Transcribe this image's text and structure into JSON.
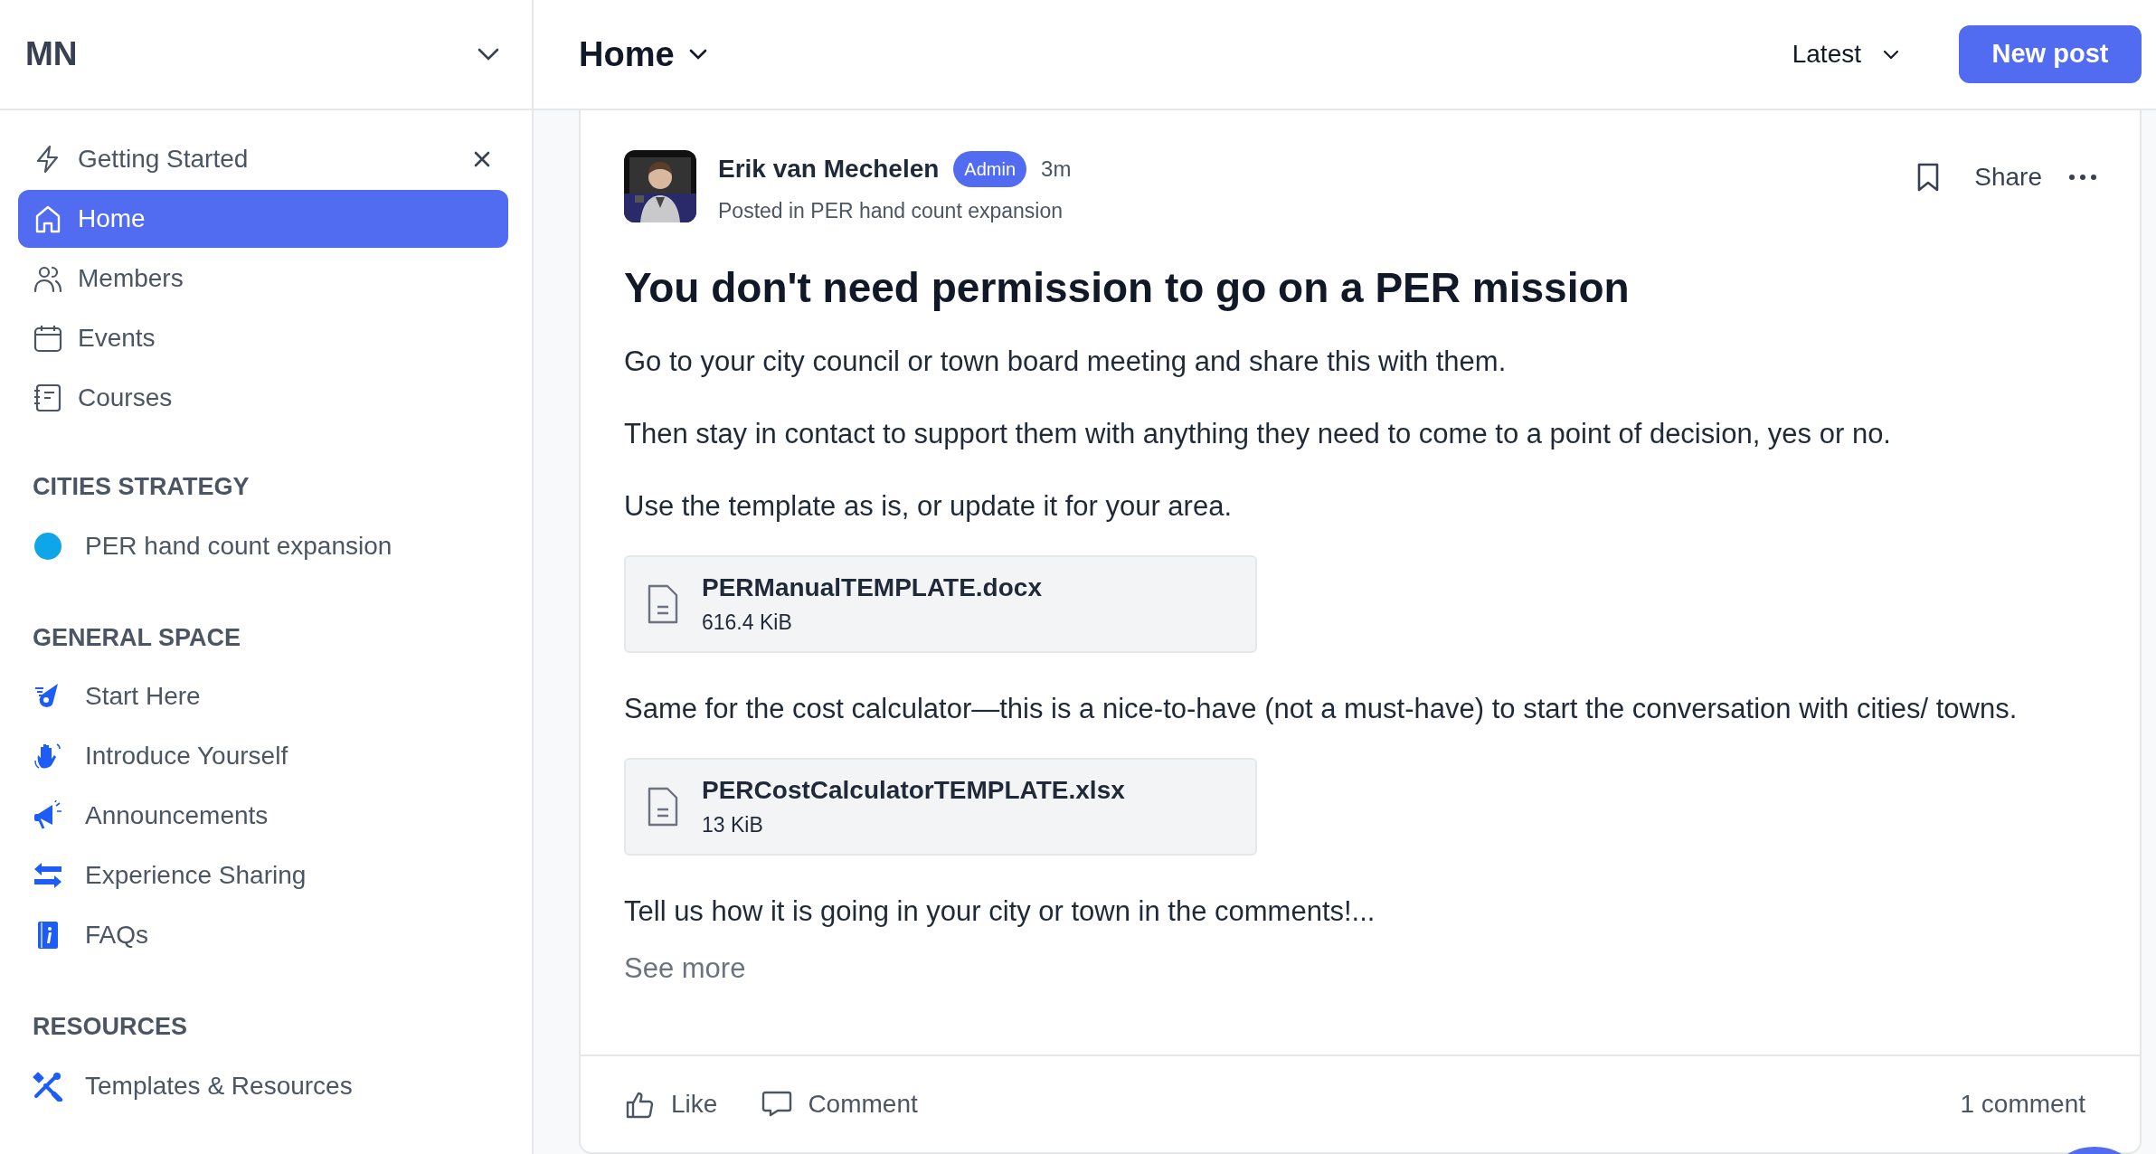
{
  "sidebar": {
    "community": "MN",
    "nav": [
      {
        "label": "Getting Started",
        "selected": false,
        "closable": true
      },
      {
        "label": "Home",
        "selected": true,
        "closable": false
      },
      {
        "label": "Members",
        "selected": false,
        "closable": false
      },
      {
        "label": "Events",
        "selected": false,
        "closable": false
      },
      {
        "label": "Courses",
        "selected": false,
        "closable": false
      }
    ],
    "sections": [
      {
        "title": "CITIES STRATEGY",
        "items": [
          {
            "label": "PER hand count expansion",
            "kind": "dot",
            "color": "#0ea5e9"
          }
        ]
      },
      {
        "title": "GENERAL SPACE",
        "items": [
          {
            "label": "Start Here",
            "kind": "icon"
          },
          {
            "label": "Introduce Yourself",
            "kind": "icon"
          },
          {
            "label": "Announcements",
            "kind": "icon"
          },
          {
            "label": "Experience Sharing",
            "kind": "icon"
          },
          {
            "label": "FAQs",
            "kind": "icon"
          }
        ]
      },
      {
        "title": "RESOURCES",
        "items": [
          {
            "label": "Templates & Resources",
            "kind": "icon"
          }
        ]
      }
    ]
  },
  "header": {
    "title": "Home",
    "sort": "Latest",
    "new_post": "New post"
  },
  "post": {
    "author": "Erik van Mechelen",
    "role": "Admin",
    "time": "3m",
    "posted_in": "Posted in PER hand count expansion",
    "share": "Share",
    "title": "You don't need permission to go on a PER mission",
    "blocks": [
      {
        "kind": "paragraph",
        "text": "Go to your city council or town board meeting and share this with them."
      },
      {
        "kind": "paragraph",
        "text": "Then stay in contact to support them with anything they need to come to a point of decision, yes or no."
      },
      {
        "kind": "paragraph",
        "text": "Use the template as is, or update it for your area."
      },
      {
        "kind": "attachment",
        "name": "PERManualTEMPLATE.docx",
        "size": "616.4 KiB"
      },
      {
        "kind": "paragraph",
        "text": "Same for the cost calculator—this is a nice-to-have (not a must-have) to start the conversation with cities/ towns."
      },
      {
        "kind": "attachment",
        "name": "PERCostCalculatorTEMPLATE.xlsx",
        "size": "13 KiB"
      },
      {
        "kind": "paragraph",
        "text": "Tell us how it is going in your city or town in the comments!..."
      }
    ],
    "see_more": "See more",
    "like": "Like",
    "comment": "Comment",
    "comment_count": "1 comment"
  }
}
